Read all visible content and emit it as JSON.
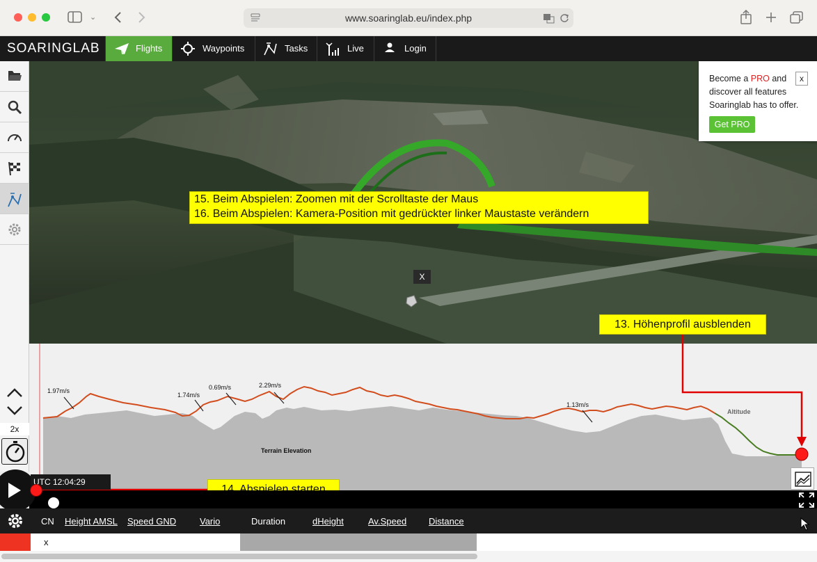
{
  "browser": {
    "url": "www.soaringlab.eu/index.php",
    "traffic_lights": [
      "#ff5f57",
      "#febc2e",
      "#28c840"
    ]
  },
  "nav": {
    "logo": "SOARINGLAB",
    "tabs": [
      {
        "label": "Flights",
        "icon": "paper-plane-icon",
        "active": true
      },
      {
        "label": "Waypoints",
        "icon": "crosshair-icon"
      },
      {
        "label": "Tasks",
        "icon": "route-icon"
      },
      {
        "label": "Live",
        "icon": "antenna-icon"
      },
      {
        "label": "Login",
        "icon": "user-icon"
      }
    ],
    "accent": "#5aab3e"
  },
  "sidebar": {
    "buttons": [
      "folder-icon",
      "search-icon",
      "speedometer-icon",
      "checkered-flag-icon",
      "task-route-icon",
      "gear-icon"
    ],
    "active": "task-route-icon",
    "speed": "2x"
  },
  "callouts": {
    "c15": "15. Beim Abspielen: Zoomen mit der Scrolltaste der Maus",
    "c16": "16. Beim Abspielen: Kamera-Position mit gedrückter linker Maustaste verändern",
    "c13": "13. Höhenprofil ausblenden",
    "c14": "14. Abspielen starten"
  },
  "map": {
    "marker_close": "X"
  },
  "pro": {
    "text_before": "Become a ",
    "text_pro": "PRO",
    "text_after": " and discover all features Soaringlab has to offer.",
    "close": "x",
    "button": "Get PRO"
  },
  "profile": {
    "terrain_label": "Terrain Elevation",
    "altitude_label": "Altitude",
    "climbs": [
      "1.97m/s",
      "1.74m/s",
      "0.69m/s",
      "2.29m/s",
      "1.13m/s"
    ]
  },
  "time": {
    "utc": "UTC 12:04:29"
  },
  "stats": {
    "columns": [
      "CN",
      "Height AMSL",
      "Speed GND",
      "Vario",
      "Duration",
      "dHeight",
      "Av.Speed",
      "Distance"
    ]
  },
  "row": {
    "cell": "x"
  }
}
